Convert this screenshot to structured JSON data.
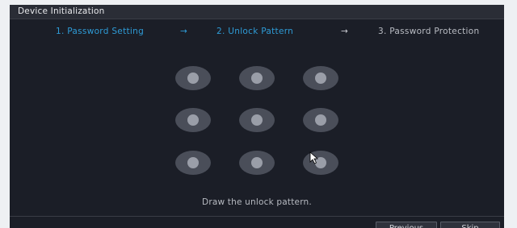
{
  "window": {
    "title": "Device Initialization"
  },
  "steps": [
    {
      "label": "1.  Password Setting",
      "state": "done"
    },
    {
      "label": "2.  Unlock Pattern",
      "state": "active"
    },
    {
      "label": "3.  Password Protection",
      "state": "pending"
    }
  ],
  "arrows": [
    "→",
    "→"
  ],
  "pattern": {
    "rows": 3,
    "cols": 3
  },
  "hint": "Draw the unlock pattern.",
  "buttons": {
    "previous": "Previous",
    "skip": "Skip"
  },
  "colors": {
    "accent": "#2e9bd6",
    "background": "#1b1e27"
  }
}
